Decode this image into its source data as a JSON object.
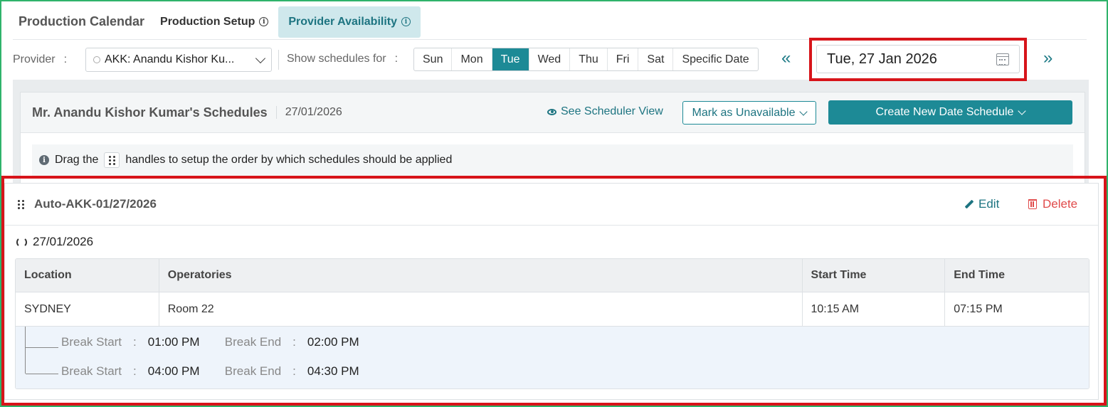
{
  "tabs": {
    "main": "Production Calendar",
    "setup": "Production Setup",
    "availability": "Provider Availability"
  },
  "filter": {
    "provider_label": "Provider",
    "provider_colon": ":",
    "provider_value": "AKK: Anandu Kishor Ku...",
    "show_label": "Show schedules for",
    "show_colon": ":",
    "days": [
      "Sun",
      "Mon",
      "Tue",
      "Wed",
      "Thu",
      "Fri",
      "Sat",
      "Specific Date"
    ],
    "active_day": "Tue",
    "prev_glyph": "«",
    "next_glyph": "»",
    "date_value": "Tue, 27 Jan 2026"
  },
  "card": {
    "title": "Mr. Anandu Kishor Kumar's Schedules",
    "date": "27/01/2026",
    "scheduler_link": "See Scheduler View",
    "mark_unavailable": "Mark as Unavailable",
    "create_new": "Create New Date Schedule",
    "hint_before": "Drag the",
    "hint_after": "handles to setup the order by which schedules should be applied"
  },
  "schedule": {
    "title": "Auto-AKK-01/27/2026",
    "edit": "Edit",
    "delete": "Delete",
    "recurrence_date": "27/01/2026",
    "columns": [
      "Location",
      "Operatories",
      "Start Time",
      "End Time"
    ],
    "row": {
      "location": "SYDNEY",
      "operatories": "Room 22",
      "start": "10:15 AM",
      "end": "07:15 PM"
    },
    "break_start_label": "Break Start",
    "break_end_label": "Break End",
    "colon": ":",
    "breaks": [
      {
        "start": "01:00 PM",
        "end": "02:00 PM"
      },
      {
        "start": "04:00 PM",
        "end": "04:30 PM"
      }
    ]
  },
  "colors": {
    "accent": "#1d8a96",
    "highlight": "#d7141a",
    "frame": "#2fb36b",
    "danger": "#e04a4a"
  }
}
